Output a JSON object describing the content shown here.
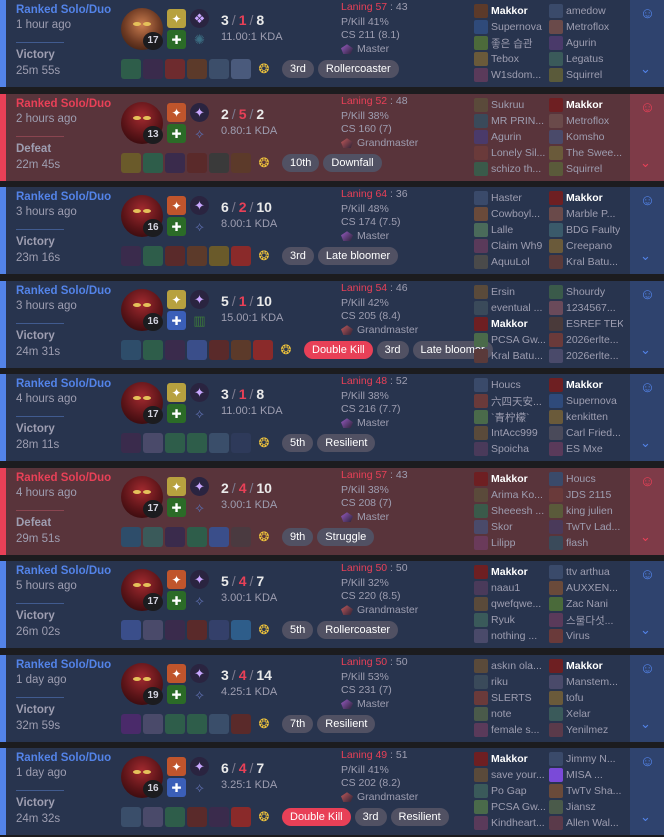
{
  "matches": [
    {
      "outcome": "win",
      "queue": "Ranked Solo/Duo",
      "ago": "1 hour ago",
      "result": "Victory",
      "duration": "25m 55s",
      "champ_variant": "alt",
      "level": "17",
      "spells": [
        "#b7a13f",
        "#2b6b27"
      ],
      "runes": [
        "#6e4fa8",
        "#3b6d82"
      ],
      "rune_icons": [
        "❖",
        "✺"
      ],
      "kda": {
        "k": "3",
        "d": "1",
        "a": "8"
      },
      "ratio": "11.00:1 KDA",
      "item_colors": [
        "#2e5d4a",
        "#3a2b4c",
        "#6e2b2e",
        "#5c3a2a",
        "#3c4e6a",
        "#4a5a7c"
      ],
      "trinket": "gold",
      "badges": [
        {
          "text": "3rd",
          "red": false
        },
        {
          "text": "Rollercoaster",
          "red": false
        }
      ],
      "laning_label": "Laning 57",
      "laning_opp": " : 43",
      "pkill": "P/Kill 41%",
      "cs": "CS 211 (8.1)",
      "rank": "Master",
      "rank_color": "#9a5cc6",
      "team_a": [
        {
          "name": "Makkor",
          "me": true,
          "color": "#5c3a2a"
        },
        {
          "name": "Supernova",
          "me": false,
          "color": "#2f4a7a"
        },
        {
          "name": "좋은 습관",
          "me": false,
          "color": "#4c6a3a"
        },
        {
          "name": "Tebox",
          "me": false,
          "color": "#6a5a3a"
        },
        {
          "name": "W1sdom...",
          "me": false,
          "color": "#5a3a5a"
        }
      ],
      "team_b": [
        {
          "name": "amedow",
          "me": false,
          "color": "#3a4a6a"
        },
        {
          "name": "Metroflox",
          "me": false,
          "color": "#6a4a4a"
        },
        {
          "name": "Agurin",
          "me": false,
          "color": "#4a3a6a"
        },
        {
          "name": "Legatus",
          "me": false,
          "color": "#3a5a5a"
        },
        {
          "name": "Squirrel",
          "me": false,
          "color": "#5a5a3a"
        }
      ]
    },
    {
      "outcome": "loss",
      "queue": "Ranked Solo/Duo",
      "ago": "2 hours ago",
      "result": "Defeat",
      "duration": "22m 45s",
      "champ_variant": "",
      "level": "13",
      "spells": [
        "#c0552c",
        "#2b6b27"
      ],
      "runes": [
        "#6e4fa8",
        "#5a6aa8"
      ],
      "rune_icons": [
        "✦",
        "⟡"
      ],
      "kda": {
        "k": "2",
        "d": "5",
        "a": "2"
      },
      "ratio": "0.80:1 KDA",
      "item_colors": [
        "#6a5a2a",
        "#2e5d4a",
        "#3a2b4c",
        "#5a2a2a",
        "#3a3a3a",
        "#5c3a2a"
      ],
      "trinket": "gold",
      "badges": [
        {
          "text": "10th",
          "red": false
        },
        {
          "text": "Downfall",
          "red": false
        }
      ],
      "laning_label": "Laning 52",
      "laning_opp": " : 48",
      "pkill": "P/Kill 38%",
      "cs": "CS 160 (7)",
      "rank": "Grandmaster",
      "rank_color": "#c75a5a",
      "team_a": [
        {
          "name": "Sukruu",
          "me": false,
          "color": "#5a4a3a"
        },
        {
          "name": "MR PRIN...",
          "me": false,
          "color": "#3a4a5a"
        },
        {
          "name": "Agurin",
          "me": false,
          "color": "#4a3a6a"
        },
        {
          "name": "Lonely Sil...",
          "me": false,
          "color": "#6a3a3a"
        },
        {
          "name": "schizo th...",
          "me": false,
          "color": "#3a5a4a"
        }
      ],
      "team_b": [
        {
          "name": "Makkor",
          "me": true,
          "color": "#6e1f22"
        },
        {
          "name": "Metroflox",
          "me": false,
          "color": "#6a4a4a"
        },
        {
          "name": "Komsho",
          "me": false,
          "color": "#4a4a6a"
        },
        {
          "name": "The Swee...",
          "me": false,
          "color": "#6a5a3a"
        },
        {
          "name": "Squirrel",
          "me": false,
          "color": "#5a5a3a"
        }
      ]
    },
    {
      "outcome": "win",
      "queue": "Ranked Solo/Duo",
      "ago": "3 hours ago",
      "result": "Victory",
      "duration": "23m 16s",
      "champ_variant": "",
      "level": "16",
      "spells": [
        "#c0552c",
        "#2b6b27"
      ],
      "runes": [
        "#6e4fa8",
        "#5a6aa8"
      ],
      "rune_icons": [
        "✦",
        "⟡"
      ],
      "kda": {
        "k": "6",
        "d": "2",
        "a": "10"
      },
      "ratio": "8.00:1 KDA",
      "item_colors": [
        "#3a2b4c",
        "#2e5d4a",
        "#5a2a2a",
        "#5c3a2a",
        "#6a5a2a",
        "#8a2a2a"
      ],
      "trinket": "gold",
      "badges": [
        {
          "text": "3rd",
          "red": false
        },
        {
          "text": "Late bloomer",
          "red": false
        }
      ],
      "laning_label": "Laning 64",
      "laning_opp": " : 36",
      "pkill": "P/Kill 48%",
      "cs": "CS 174 (7.5)",
      "rank": "Master",
      "rank_color": "#9a5cc6",
      "team_a": [
        {
          "name": "Haster",
          "me": false,
          "color": "#3a4a6a"
        },
        {
          "name": "Cowboyl...",
          "me": false,
          "color": "#6a4a3a"
        },
        {
          "name": "Lalle",
          "me": false,
          "color": "#4a6a5a"
        },
        {
          "name": "Claim Wh9",
          "me": false,
          "color": "#5a3a5a"
        },
        {
          "name": "AquuLol",
          "me": false,
          "color": "#4a4a4a"
        }
      ],
      "team_b": [
        {
          "name": "Makkor",
          "me": true,
          "color": "#6e1f22"
        },
        {
          "name": "Marble P...",
          "me": false,
          "color": "#6a4a4a"
        },
        {
          "name": "BDG Faulty",
          "me": false,
          "color": "#3a5a6a"
        },
        {
          "name": "Creepano",
          "me": false,
          "color": "#6a5a3a"
        },
        {
          "name": "Kral Batu...",
          "me": false,
          "color": "#5a3a3a"
        }
      ]
    },
    {
      "outcome": "win",
      "queue": "Ranked Solo/Duo",
      "ago": "3 hours ago",
      "result": "Victory",
      "duration": "24m 31s",
      "champ_variant": "",
      "level": "16",
      "spells": [
        "#b7a13f",
        "#3b5fb8"
      ],
      "runes": [
        "#6e4fa8",
        "#3c7a3a"
      ],
      "rune_icons": [
        "✦",
        "▥"
      ],
      "kda": {
        "k": "5",
        "d": "1",
        "a": "10"
      },
      "ratio": "15.00:1 KDA",
      "item_colors": [
        "#2e4d6a",
        "#2e5d4a",
        "#3a2b4c",
        "#3a4e8a",
        "#5a2a2a",
        "#5c3a2a",
        "#8a2a2a"
      ],
      "trinket": "gold-blue",
      "badges": [
        {
          "text": "Double Kill",
          "red": true
        },
        {
          "text": "3rd",
          "red": false
        },
        {
          "text": "Late bloomer",
          "red": false
        }
      ],
      "laning_label": "Laning 54",
      "laning_opp": " : 46",
      "pkill": "P/Kill 42%",
      "cs": "CS 205 (8.4)",
      "rank": "Grandmaster",
      "rank_color": "#c75a5a",
      "team_a": [
        {
          "name": "Ersin",
          "me": false,
          "color": "#5a4a3a"
        },
        {
          "name": "eventual ...",
          "me": false,
          "color": "#3a4a5a"
        },
        {
          "name": "Makkor",
          "me": true,
          "color": "#6e1f22"
        },
        {
          "name": "PCSA Gw...",
          "me": false,
          "color": "#4a6a4a"
        },
        {
          "name": "Kral Batu...",
          "me": false,
          "color": "#5a3a3a"
        }
      ],
      "team_b": [
        {
          "name": "Shourdy",
          "me": false,
          "color": "#3a5a4a"
        },
        {
          "name": "1234567...",
          "me": false,
          "color": "#6a4a5a"
        },
        {
          "name": "ESREF TEK",
          "me": false,
          "color": "#4a3a3a"
        },
        {
          "name": "2026erlte...",
          "me": false,
          "color": "#6a3a3a"
        },
        {
          "name": "2026erlte...",
          "me": false,
          "color": "#4a4a6a"
        }
      ]
    },
    {
      "outcome": "win",
      "queue": "Ranked Solo/Duo",
      "ago": "4 hours ago",
      "result": "Victory",
      "duration": "28m 11s",
      "champ_variant": "",
      "level": "17",
      "spells": [
        "#b7a13f",
        "#2b6b27"
      ],
      "runes": [
        "#6e4fa8",
        "#5a6aa8"
      ],
      "rune_icons": [
        "✦",
        "⟡"
      ],
      "kda": {
        "k": "3",
        "d": "1",
        "a": "8"
      },
      "ratio": "11.00:1 KDA",
      "item_colors": [
        "#3a2b4c",
        "#4a4a6a",
        "#2e5d4a",
        "#2e5d4a",
        "#3a4e6a",
        "#2e3a5a"
      ],
      "trinket": "gold",
      "badges": [
        {
          "text": "5th",
          "red": false
        },
        {
          "text": "Resilient",
          "red": false
        }
      ],
      "laning_label": "Laning 48",
      "laning_opp": " : 52",
      "pkill": "P/Kill 38%",
      "cs": "CS 216 (7.7)",
      "rank": "Master",
      "rank_color": "#9a5cc6",
      "team_a": [
        {
          "name": "Houcs",
          "me": false,
          "color": "#3a4a6a"
        },
        {
          "name": "六四天安...",
          "me": false,
          "color": "#6a3a3a"
        },
        {
          "name": "`青柠檬`",
          "me": false,
          "color": "#4a6a4a"
        },
        {
          "name": "IntAcc999",
          "me": false,
          "color": "#5a4a3a"
        },
        {
          "name": "Spoicha",
          "me": false,
          "color": "#4a3a5a"
        }
      ],
      "team_b": [
        {
          "name": "Makkor",
          "me": true,
          "color": "#6e1f22"
        },
        {
          "name": "Supernova",
          "me": false,
          "color": "#2f4a7a"
        },
        {
          "name": "kenkitten",
          "me": false,
          "color": "#6a5a3a"
        },
        {
          "name": "Carl Fried...",
          "me": false,
          "color": "#4a4a5a"
        },
        {
          "name": "ES Mxe",
          "me": false,
          "color": "#5a3a5a"
        }
      ]
    },
    {
      "outcome": "loss",
      "queue": "Ranked Solo/Duo",
      "ago": "4 hours ago",
      "result": "Defeat",
      "duration": "29m 51s",
      "champ_variant": "",
      "level": "17",
      "spells": [
        "#b7a13f",
        "#2b6b27"
      ],
      "runes": [
        "#6e4fa8",
        "#5a6aa8"
      ],
      "rune_icons": [
        "✦",
        "⟡"
      ],
      "kda": {
        "k": "2",
        "d": "4",
        "a": "10"
      },
      "ratio": "3.00:1 KDA",
      "item_colors": [
        "#2e4d6a",
        "#3a5a5a",
        "#3a2b4c",
        "#2e5d4a",
        "#3a4e8a",
        "#4a3a40"
      ],
      "trinket": "gold",
      "badges": [
        {
          "text": "9th",
          "red": false
        },
        {
          "text": "Struggle",
          "red": false
        }
      ],
      "laning_label": "Laning 57",
      "laning_opp": " : 43",
      "pkill": "P/Kill 38%",
      "cs": "CS 208 (7)",
      "rank": "Master",
      "rank_color": "#9a5cc6",
      "team_a": [
        {
          "name": "Makkor",
          "me": true,
          "color": "#6e1f22"
        },
        {
          "name": "Arima Ko...",
          "me": false,
          "color": "#5a4a3a"
        },
        {
          "name": "Sheeesh ...",
          "me": false,
          "color": "#3a5a4a"
        },
        {
          "name": "Skor",
          "me": false,
          "color": "#4a4a6a"
        },
        {
          "name": "Lilipp",
          "me": false,
          "color": "#6a3a5a"
        }
      ],
      "team_b": [
        {
          "name": "Houcs",
          "me": false,
          "color": "#3a4a6a"
        },
        {
          "name": "JDS 2115",
          "me": false,
          "color": "#6a3a3a"
        },
        {
          "name": "king julien",
          "me": false,
          "color": "#5a5a3a"
        },
        {
          "name": "TwTv Lad...",
          "me": false,
          "color": "#4a3a5a"
        },
        {
          "name": "fłash",
          "me": false,
          "color": "#3a4a5a"
        }
      ]
    },
    {
      "outcome": "win",
      "queue": "Ranked Solo/Duo",
      "ago": "5 hours ago",
      "result": "Victory",
      "duration": "26m 02s",
      "champ_variant": "",
      "level": "17",
      "spells": [
        "#c0552c",
        "#2b6b27"
      ],
      "runes": [
        "#6e4fa8",
        "#5a6aa8"
      ],
      "rune_icons": [
        "✦",
        "⟡"
      ],
      "kda": {
        "k": "5",
        "d": "4",
        "a": "7"
      },
      "ratio": "3.00:1 KDA",
      "item_colors": [
        "#3a4e8a",
        "#4a4a6a",
        "#3a2b4c",
        "#5a2a2a",
        "#34406a",
        "#2e5d8a"
      ],
      "trinket": "gold",
      "badges": [
        {
          "text": "5th",
          "red": false
        },
        {
          "text": "Rollercoaster",
          "red": false
        }
      ],
      "laning_label": "Laning 50",
      "laning_opp": " : 50",
      "pkill": "P/Kill 32%",
      "cs": "CS 220 (8.5)",
      "rank": "Grandmaster",
      "rank_color": "#c75a5a",
      "team_a": [
        {
          "name": "Makkor",
          "me": true,
          "color": "#6e1f22"
        },
        {
          "name": "naau1",
          "me": false,
          "color": "#4a3a5a"
        },
        {
          "name": "qwefqwe...",
          "me": false,
          "color": "#5a4a3a"
        },
        {
          "name": "Ryuk",
          "me": false,
          "color": "#3a5a5a"
        },
        {
          "name": "nothing ...",
          "me": false,
          "color": "#4a4a6a"
        }
      ],
      "team_b": [
        {
          "name": "ttv arthua",
          "me": false,
          "color": "#3a4a6a"
        },
        {
          "name": "AUXXEN...",
          "me": false,
          "color": "#6a4a3a"
        },
        {
          "name": "Zac Nani",
          "me": false,
          "color": "#4a6a3a"
        },
        {
          "name": "스물다섯...",
          "me": false,
          "color": "#5a3a5a"
        },
        {
          "name": "Virus",
          "me": false,
          "color": "#6a3a3a"
        }
      ]
    },
    {
      "outcome": "win",
      "queue": "Ranked Solo/Duo",
      "ago": "1 day ago",
      "result": "Victory",
      "duration": "32m 59s",
      "champ_variant": "",
      "level": "19",
      "spells": [
        "#c0552c",
        "#2b6b27"
      ],
      "runes": [
        "#6e4fa8",
        "#5a6aa8"
      ],
      "rune_icons": [
        "✦",
        "⟡"
      ],
      "kda": {
        "k": "3",
        "d": "4",
        "a": "14"
      },
      "ratio": "4.25:1 KDA",
      "item_colors": [
        "#4a2a6a",
        "#4a4a6a",
        "#2e5d4a",
        "#2e5d4a",
        "#3a4e6a",
        "#5a2a2a"
      ],
      "trinket": "gold",
      "badges": [
        {
          "text": "7th",
          "red": false
        },
        {
          "text": "Resilient",
          "red": false
        }
      ],
      "laning_label": "Laning 50",
      "laning_opp": " : 50",
      "pkill": "P/Kill 53%",
      "cs": "CS 231 (7)",
      "rank": "Master",
      "rank_color": "#9a5cc6",
      "team_a": [
        {
          "name": "askın ola...",
          "me": false,
          "color": "#5a4a3a"
        },
        {
          "name": "riku",
          "me": false,
          "color": "#3a4a5a"
        },
        {
          "name": "SLERTS",
          "me": false,
          "color": "#6a3a3a"
        },
        {
          "name": "note",
          "me": false,
          "color": "#4a5a4a"
        },
        {
          "name": "female s...",
          "me": false,
          "color": "#5a3a5a"
        }
      ],
      "team_b": [
        {
          "name": "Makkor",
          "me": true,
          "color": "#6e1f22"
        },
        {
          "name": "Manstem...",
          "me": false,
          "color": "#4a4a6a"
        },
        {
          "name": "tofu",
          "me": false,
          "color": "#6a5a3a"
        },
        {
          "name": "Xelar",
          "me": false,
          "color": "#3a5a5a"
        },
        {
          "name": "Yenilmez",
          "me": false,
          "color": "#5a3a4a"
        }
      ]
    },
    {
      "outcome": "win",
      "queue": "Ranked Solo/Duo",
      "ago": "1 day ago",
      "result": "Victory",
      "duration": "24m 32s",
      "champ_variant": "",
      "level": "16",
      "spells": [
        "#c0552c",
        "#3b5fb8"
      ],
      "runes": [
        "#6e4fa8",
        "#5a6aa8"
      ],
      "rune_icons": [
        "✦",
        "⟡"
      ],
      "kda": {
        "k": "6",
        "d": "4",
        "a": "7"
      },
      "ratio": "3.25:1 KDA",
      "item_colors": [
        "#3a4e6a",
        "#4a4a6a",
        "#2e5d4a",
        "#5a2a2a",
        "#3a2b4c",
        "#8a2a2a"
      ],
      "trinket": "gold",
      "badges": [
        {
          "text": "Double Kill",
          "red": true
        },
        {
          "text": "3rd",
          "red": false
        },
        {
          "text": "Resilient",
          "red": false
        }
      ],
      "laning_label": "Laning 49",
      "laning_opp": " : 51",
      "pkill": "P/Kill 41%",
      "cs": "CS 202 (8.2)",
      "rank": "Grandmaster",
      "rank_color": "#c75a5a",
      "team_a": [
        {
          "name": "Makkor",
          "me": true,
          "color": "#6e1f22"
        },
        {
          "name": "save your...",
          "me": false,
          "color": "#5a4a3a"
        },
        {
          "name": "Po Gap",
          "me": false,
          "color": "#3a5a5a"
        },
        {
          "name": "PCSA Gw...",
          "me": false,
          "color": "#4a6a4a"
        },
        {
          "name": "Kindheart...",
          "me": false,
          "color": "#5a3a5a"
        }
      ],
      "team_b": [
        {
          "name": "Jimmy N...",
          "me": false,
          "color": "#3a4a6a"
        },
        {
          "name": "MISA ...",
          "me": false,
          "color": "#7a4ad8"
        },
        {
          "name": "TwTv Sha...",
          "me": false,
          "color": "#6a4a3a"
        },
        {
          "name": "Jiansz",
          "me": false,
          "color": "#4a5a4a"
        },
        {
          "name": "Allen Wal...",
          "me": false,
          "color": "#5a3a4a"
        }
      ]
    }
  ]
}
